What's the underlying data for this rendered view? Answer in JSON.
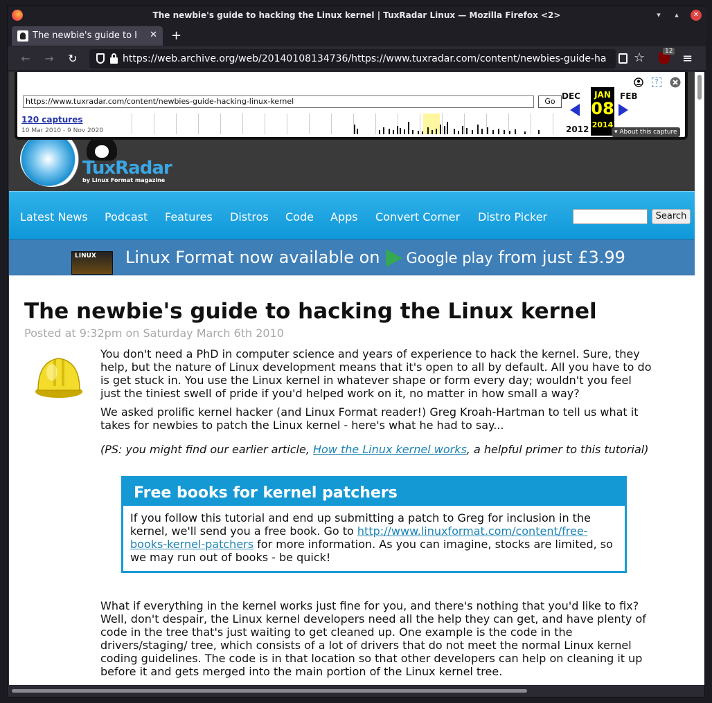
{
  "window": {
    "title": "The newbie's guide to hacking the Linux kernel | TuxRadar Linux — Mozilla Firefox <2>",
    "controls": {
      "minimize": "▾",
      "maximize": "▴",
      "close": "✕"
    }
  },
  "tabs": [
    {
      "label": "The newbie's guide to hac",
      "close": "✕"
    }
  ],
  "newtab_label": "+",
  "navbar": {
    "back": "←",
    "forward": "→",
    "reload": "↻",
    "url": "https://web.archive.org/web/20140108134736/https://www.tuxradar.com/content/newbies-guide-ha",
    "bookmark": "☆",
    "ublock_count": "12",
    "menu": "≡"
  },
  "wayback": {
    "url": "https://www.tuxradar.com/content/newbies-guide-hacking-linux-kernel",
    "go": "Go",
    "captures": "120 captures",
    "range": "10 Mar 2010 - 9 Nov 2020",
    "prev_month": "DEC",
    "cur_month": "JAN",
    "cur_day": "08",
    "cur_year": "2014",
    "next_month": "FEB",
    "prev_year": "2012",
    "about": "▾ About this capture"
  },
  "site": {
    "logo_text": "TuxRadar",
    "logo_sub": "by Linux Format magazine",
    "nav": [
      "Latest News",
      "Podcast",
      "Features",
      "Distros",
      "Code",
      "Apps",
      "Convert Corner",
      "Distro Picker"
    ],
    "search_button": "Search",
    "banner": {
      "mag_label": "LINUX",
      "pre": "Linux Format now available on",
      "store": "Google play",
      "post": "from just £3.99"
    }
  },
  "article": {
    "title": "The newbie's guide to hacking the Linux kernel",
    "posted": "Posted at 9:32pm on Saturday March 6th 2010",
    "p1": "You don't need a PhD in computer science and years of experience to hack the kernel. Sure, they help, but the nature of Linux development means that it's open to all by default. All you have to do is get stuck in. You use the Linux kernel in whatever shape or form every day; wouldn't you feel just the tiniest swell of pride if you'd helped work on it, no matter in how small a way?",
    "p2": "We asked prolific kernel hacker (and Linux Format reader!) Greg Kroah-Hartman to tell us what it takes for newbies to patch the Linux kernel - here's what he had to say...",
    "p3_pre": "(PS: you might find our earlier article, ",
    "p3_link": "How the Linux kernel works",
    "p3_post": ", a helpful primer to this tutorial)",
    "box_title": "Free books for kernel patchers",
    "box_pre": "If you follow this tutorial and end up submitting a patch to Greg for inclusion in the kernel, we'll send you a free book. Go to ",
    "box_link": "http://www.linuxformat.com/content/free-books-kernel-patchers",
    "box_post": " for more information. As you can imagine, stocks are limited, so we may run out of books - be quick!",
    "p4": "What if everything in the kernel works just fine for you, and there's nothing that you'd like to fix? Well, don't despair, the Linux kernel developers need all the help they can get, and have plenty of code in the tree that's just waiting to get cleaned up. One example is the code in the drivers/staging/ tree, which consists of a lot of drivers that do not meet the normal Linux kernel coding guidelines. The code is in that location so that other developers can help on cleaning it up before it and gets merged into the main portion of the Linux kernel tree."
  }
}
